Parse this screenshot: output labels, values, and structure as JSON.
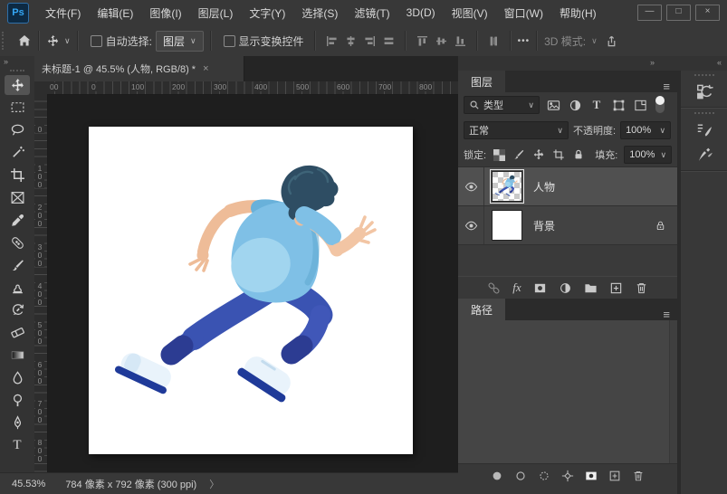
{
  "colors": {
    "accent_blue": "#34a7f5",
    "panel_bg": "#383838",
    "pasteboard": "#1e1e1e",
    "canvas": "#ffffff",
    "selected_layer_row": "#505050",
    "figure_shirt": "#7fc0e6",
    "figure_pants": "#3a53b2",
    "figure_hair": "#2e4d63",
    "figure_skin": "#f2c5a4"
  },
  "menubar": {
    "logo": "Ps",
    "items": [
      "文件(F)",
      "编辑(E)",
      "图像(I)",
      "图层(L)",
      "文字(Y)",
      "选择(S)",
      "滤镜(T)",
      "3D(D)",
      "视图(V)",
      "窗口(W)",
      "帮助(H)"
    ],
    "window_controls": {
      "minimize": "—",
      "maximize": "□",
      "close": "×"
    }
  },
  "options": {
    "auto_select_label": "自动选择:",
    "auto_select_value": "图层",
    "show_transform_label": "显示变换控件",
    "more_label": "•••",
    "mode3d_label": "3D 模式:",
    "chevron": "∨"
  },
  "doc": {
    "tab_title": "未标题-1 @ 45.5% (人物, RGB/8) *",
    "tab_close": "×",
    "hruler": [
      {
        "t": "00",
        "p": 2
      },
      {
        "t": "0",
        "p": 48
      },
      {
        "t": "100",
        "p": 92
      },
      {
        "t": "200",
        "p": 137
      },
      {
        "t": "300",
        "p": 183
      },
      {
        "t": "400",
        "p": 228
      },
      {
        "t": "500",
        "p": 274
      },
      {
        "t": "600",
        "p": 319
      },
      {
        "t": "700",
        "p": 365
      },
      {
        "t": "800",
        "p": 410
      }
    ],
    "vruler": [
      {
        "t": "0",
        "p": 34
      },
      {
        "t": "100",
        "p": 77
      },
      {
        "t": "200",
        "p": 120
      },
      {
        "t": "300",
        "p": 164
      },
      {
        "t": "400",
        "p": 207
      },
      {
        "t": "500",
        "p": 250
      },
      {
        "t": "600",
        "p": 294
      },
      {
        "t": "700",
        "p": 337
      },
      {
        "t": "800",
        "p": 380
      }
    ],
    "status_zoom": "45.53%",
    "status_dims": "784 像素 x 792 像素 (300 ppi)",
    "status_chevron": "〉"
  },
  "layers_panel": {
    "title": "图层",
    "menu_icon": "≡",
    "filter_value": "类型",
    "blend_mode": "正常",
    "opacity_label": "不透明度:",
    "opacity_value": "100%",
    "lock_label": "锁定:",
    "fill_label": "填充:",
    "fill_value": "100%",
    "fx_label": "fx",
    "rows": [
      {
        "name": "人物",
        "selected": true,
        "locked": false
      },
      {
        "name": "背景",
        "selected": false,
        "locked": true
      }
    ]
  },
  "paths_panel": {
    "title": "路径",
    "menu_icon": "≡"
  },
  "collapse_icons": {
    "panel_collapse": "»",
    "strip_expand": "«",
    "toolbar_collapse": "»"
  }
}
